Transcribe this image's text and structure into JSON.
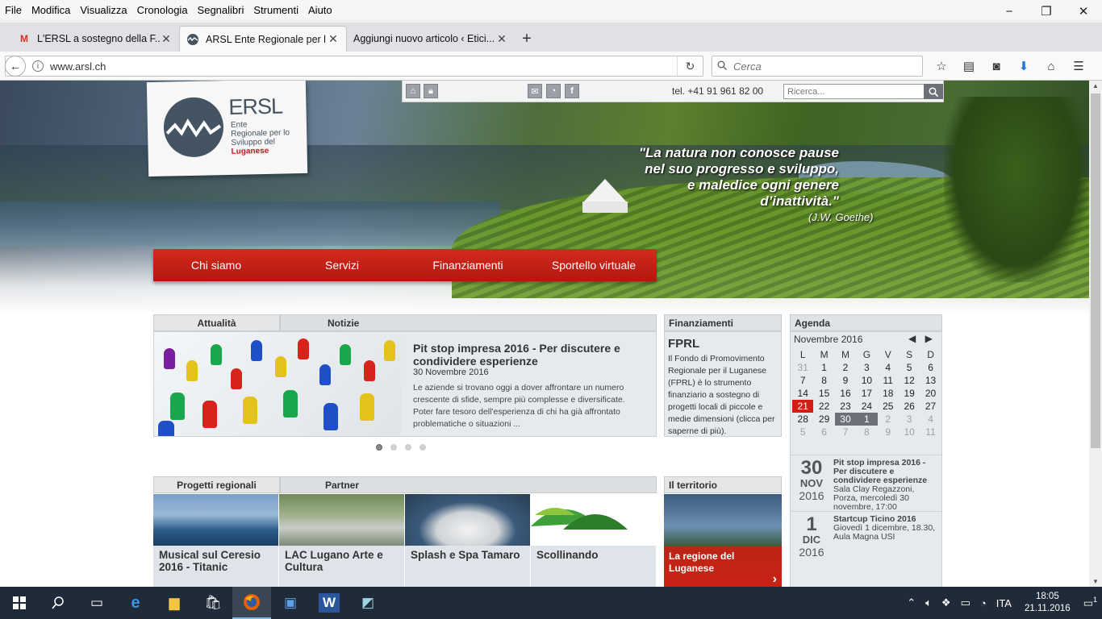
{
  "menu": [
    "File",
    "Modifica",
    "Visualizza",
    "Cronologia",
    "Segnalibri",
    "Strumenti",
    "Aiuto"
  ],
  "window_controls": [
    "−",
    "❐",
    "✕"
  ],
  "tabs": [
    {
      "label": "L'ERSL a sostegno della F...",
      "icon": "gmail-icon"
    },
    {
      "label": "ARSL Ente Regionale per l...",
      "icon": "ersl-favicon"
    },
    {
      "label": "Aggiungi nuovo articolo ‹ Etici...",
      "icon": "none"
    }
  ],
  "address": {
    "url": "www.arsl.ch"
  },
  "search": {
    "placeholder": "Cerca"
  },
  "site": {
    "phone": "tel. +41 91 961 82 00",
    "search_placeholder": "Ricerca...",
    "logo": {
      "brand": "ERSL",
      "line1": "Ente",
      "line2": "Regionale per lo",
      "line3": "Sviluppo del",
      "line4": "Luganese"
    },
    "quote": {
      "l1": "\"La natura non conosce pause",
      "l2": "nel suo progresso e sviluppo,",
      "l3": "e maledice ogni genere",
      "l4": "d’inattività.\"",
      "author": "(J.W. Goethe)"
    },
    "nav": [
      "Chi siamo",
      "Servizi",
      "Finanziamenti",
      "Sportello virtuale"
    ],
    "news_tabs": [
      "Attualità",
      "Notizie"
    ],
    "news": {
      "title": "Pit stop impresa 2016 - Per discutere e condividere esperienze",
      "date": "30 Novembre 2016",
      "text": "Le aziende si trovano oggi a dover affrontare un numero crescente di sfide, sempre più complesse e diversificate. Poter fare tesoro dell'esperienza di chi ha già affrontato problematiche o situazioni ..."
    },
    "finanziamenti": {
      "header": "Finanziamenti",
      "title": "FPRL",
      "text": "Il Fondo di Promovimento Regionale per il Luganese (FPRL) è lo strumento finanziario a sostegno di progetti locali di piccole e medie dimensioni (clicca per saperne di più)."
    },
    "agenda": {
      "header": "Agenda",
      "month": "Novembre 2016",
      "dow": [
        "L",
        "M",
        "M",
        "G",
        "V",
        "S",
        "D"
      ],
      "days": [
        {
          "d": "31",
          "c": "dim"
        },
        {
          "d": "1"
        },
        {
          "d": "2"
        },
        {
          "d": "3"
        },
        {
          "d": "4"
        },
        {
          "d": "5"
        },
        {
          "d": "6"
        },
        {
          "d": "7"
        },
        {
          "d": "8"
        },
        {
          "d": "9"
        },
        {
          "d": "10"
        },
        {
          "d": "11"
        },
        {
          "d": "12"
        },
        {
          "d": "13"
        },
        {
          "d": "14"
        },
        {
          "d": "15"
        },
        {
          "d": "16"
        },
        {
          "d": "17"
        },
        {
          "d": "18"
        },
        {
          "d": "19"
        },
        {
          "d": "20"
        },
        {
          "d": "21",
          "c": "today"
        },
        {
          "d": "22"
        },
        {
          "d": "23"
        },
        {
          "d": "24"
        },
        {
          "d": "25"
        },
        {
          "d": "26"
        },
        {
          "d": "27"
        },
        {
          "d": "28"
        },
        {
          "d": "29"
        },
        {
          "d": "30",
          "c": "ev"
        },
        {
          "d": "1",
          "c": "ev"
        },
        {
          "d": "2",
          "c": "dim"
        },
        {
          "d": "3",
          "c": "dim"
        },
        {
          "d": "4",
          "c": "dim"
        },
        {
          "d": "5",
          "c": "dim"
        },
        {
          "d": "6",
          "c": "dim"
        },
        {
          "d": "7",
          "c": "dim"
        },
        {
          "d": "8",
          "c": "dim"
        },
        {
          "d": "9",
          "c": "dim"
        },
        {
          "d": "10",
          "c": "dim"
        },
        {
          "d": "11",
          "c": "dim"
        }
      ],
      "events": [
        {
          "day": "30",
          "month": "NOV",
          "year": "2016",
          "title": "Pit stop impresa 2016 - Per discutere e condividere esperienze",
          "detail": "Sala Clay Regazzoni, Porza, mercoledì 30 novembre, 17:00"
        },
        {
          "day": "1",
          "month": "DIC",
          "year": "2016",
          "title": "Startcup Ticino 2016",
          "detail": "Giovedì 1 dicembre, 18.30, Aula Magna USI"
        }
      ]
    },
    "projects_tabs": [
      "Progetti regionali",
      "Partner"
    ],
    "projects": [
      {
        "label": "Musical sul Ceresio 2016 - Titanic"
      },
      {
        "label": "LAC Lugano Arte e Cultura"
      },
      {
        "label": "Splash e Spa Tamaro"
      },
      {
        "label": "Scollinando"
      }
    ],
    "territorio": {
      "header": "Il territorio",
      "label": "La regione del Luganese",
      "arrow": "›"
    }
  },
  "taskbar": {
    "lang": "ITA",
    "time": "18:05",
    "date": "21.11.2016",
    "notifications": "1"
  },
  "colors": {
    "accent_red": "#c8161d",
    "nav_red": "#c22216",
    "brand_gray": "#455463"
  }
}
